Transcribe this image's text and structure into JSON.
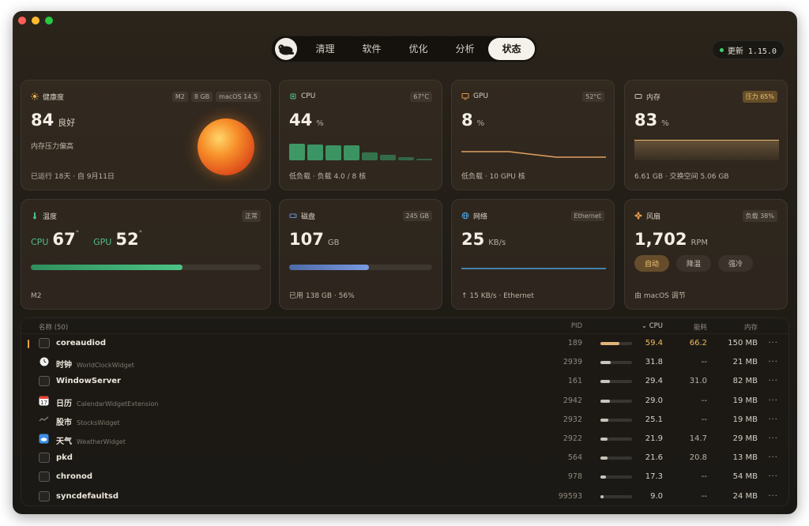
{
  "nav": {
    "tabs": [
      {
        "label": "清理"
      },
      {
        "label": "软件"
      },
      {
        "label": "优化"
      },
      {
        "label": "分析"
      },
      {
        "label": "状态"
      }
    ],
    "active_tab": "状态"
  },
  "update_button": "更新 1.15.0",
  "cards": {
    "health": {
      "title": "健康度",
      "badges": [
        "M2",
        "8 GB",
        "macOS 14.5"
      ],
      "value": "84",
      "status": "良好",
      "note": "内存压力偏高",
      "footer": "已运行 18天 · 自 9月11日"
    },
    "cpu": {
      "title": "CPU",
      "badge": "67°C",
      "value": "44",
      "unit": "%",
      "footer": "低负载 · 负载 4.0 / 8 核",
      "core_loads": [
        0.95,
        0.9,
        0.88,
        0.86,
        0.45,
        0.3,
        0.2,
        0.1
      ]
    },
    "gpu": {
      "title": "GPU",
      "badge": "52°C",
      "value": "8",
      "unit": "%",
      "footer": "低负载 · 10 GPU 核"
    },
    "memory": {
      "title": "内存",
      "badge": "压力 65%",
      "value": "83",
      "unit": "%",
      "footer": "6.61 GB · 交换空间 5.06 GB"
    },
    "temperature": {
      "title": "温度",
      "badge": "正常",
      "cpu_label": "CPU",
      "cpu_value": "67",
      "gpu_label": "GPU",
      "gpu_value": "52",
      "degree": "°",
      "fill": 0.66,
      "footer": "M2"
    },
    "disk": {
      "title": "磁盘",
      "badge": "245 GB",
      "value": "107",
      "unit": "GB",
      "fill": 0.56,
      "footer": "已用 138 GB · 56%"
    },
    "network": {
      "title": "网络",
      "badge": "Ethernet",
      "value": "25",
      "unit": "KB/s",
      "footer": "↑ 15 KB/s · Ethernet"
    },
    "fan": {
      "title": "风扇",
      "badge": "负载 38%",
      "value": "1,702",
      "unit": "RPM",
      "modes": [
        "自动",
        "降温",
        "强冷"
      ],
      "active_mode": "自动",
      "footer": "由 macOS 调节"
    }
  },
  "process_table": {
    "headers": {
      "name": "名称 (50)",
      "pid": "PID",
      "cpu": "CPU",
      "energy": "能耗",
      "memory": "内存"
    },
    "rows": [
      {
        "name": "coreaudiod",
        "sub": "",
        "pid": "189",
        "cpu": "59.4",
        "cpu_level": 0.6,
        "energy": "66.2",
        "memory": "150 MB",
        "icon": "terminal-icon",
        "highlight": true
      },
      {
        "name": "时钟",
        "sub": "WorldClockWidget",
        "pid": "2939",
        "cpu": "31.8",
        "cpu_level": 0.32,
        "energy": "--",
        "memory": "21 MB",
        "icon": "clock-icon",
        "highlight": false
      },
      {
        "name": "WindowServer",
        "sub": "",
        "pid": "161",
        "cpu": "29.4",
        "cpu_level": 0.3,
        "energy": "31.0",
        "memory": "82 MB",
        "icon": "terminal-icon",
        "highlight": false
      },
      {
        "name": "日历",
        "sub": "CalendarWidgetExtension",
        "pid": "2942",
        "cpu": "29.0",
        "cpu_level": 0.29,
        "energy": "--",
        "memory": "19 MB",
        "icon": "calendar-icon",
        "highlight": false
      },
      {
        "name": "股市",
        "sub": "StocksWidget",
        "pid": "2932",
        "cpu": "25.1",
        "cpu_level": 0.25,
        "energy": "--",
        "memory": "19 MB",
        "icon": "stocks-icon",
        "highlight": false
      },
      {
        "name": "天气",
        "sub": "WeatherWidget",
        "pid": "2922",
        "cpu": "21.9",
        "cpu_level": 0.22,
        "energy": "14.7",
        "memory": "29 MB",
        "icon": "weather-icon",
        "highlight": false
      },
      {
        "name": "pkd",
        "sub": "",
        "pid": "564",
        "cpu": "21.6",
        "cpu_level": 0.22,
        "energy": "20.8",
        "memory": "13 MB",
        "icon": "terminal-icon",
        "highlight": false
      },
      {
        "name": "chronod",
        "sub": "",
        "pid": "978",
        "cpu": "17.3",
        "cpu_level": 0.17,
        "energy": "--",
        "memory": "54 MB",
        "icon": "terminal-icon",
        "highlight": false
      },
      {
        "name": "syncdefaultsd",
        "sub": "",
        "pid": "99593",
        "cpu": "9.0",
        "cpu_level": 0.09,
        "energy": "--",
        "memory": "24 MB",
        "icon": "terminal-icon",
        "highlight": false
      }
    ],
    "more_label": "···"
  }
}
